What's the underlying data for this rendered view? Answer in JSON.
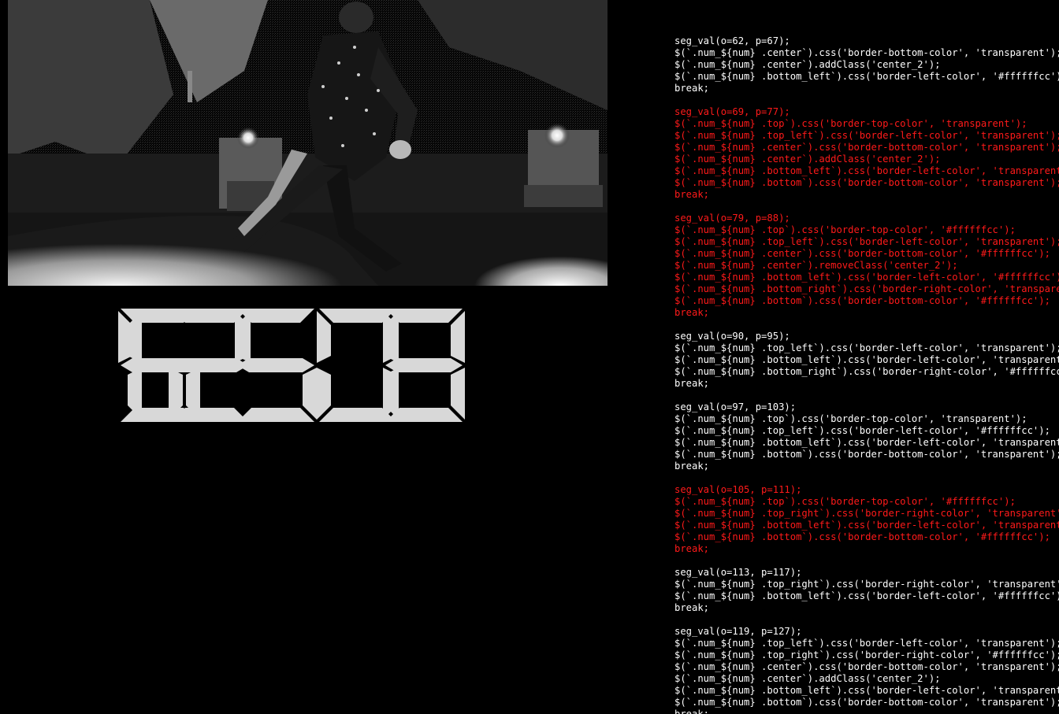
{
  "video": {
    "subject": "grayscale dither video frame of a dancer mid-step"
  },
  "clock": {
    "digits": [
      "1",
      "5",
      "2",
      "5",
      "0",
      "8"
    ],
    "segment_color": "#d8d8d8"
  },
  "code": {
    "highlight_color": "#ff1a1a",
    "text_color": "#ffffff",
    "blocks": [
      {
        "highlight": false,
        "lines": [
          "seg_val(o=62, p=67);",
          "$(`.num_${num} .center`).css('border-bottom-color', 'transparent');",
          "$(`.num_${num} .center`).addClass('center_2');",
          "$(`.num_${num} .bottom_left`).css('border-left-color', '#ffffffcc');",
          "break;"
        ]
      },
      {
        "highlight": true,
        "lines": [
          "seg_val(o=69, p=77);",
          "$(`.num_${num} .top`).css('border-top-color', 'transparent');",
          "$(`.num_${num} .top_left`).css('border-left-color', 'transparent');",
          "$(`.num_${num} .center`).css('border-bottom-color', 'transparent');",
          "$(`.num_${num} .center`).addClass('center_2');",
          "$(`.num_${num} .bottom_left`).css('border-left-color', 'transparent');",
          "$(`.num_${num} .bottom`).css('border-bottom-color', 'transparent');",
          "break;"
        ]
      },
      {
        "highlight": true,
        "lines": [
          "seg_val(o=79, p=88);",
          "$(`.num_${num} .top`).css('border-top-color', '#ffffffcc');",
          "$(`.num_${num} .top_left`).css('border-left-color', 'transparent');",
          "$(`.num_${num} .center`).css('border-bottom-color', '#ffffffcc');",
          "$(`.num_${num} .center`).removeClass('center_2');",
          "$(`.num_${num} .bottom_left`).css('border-left-color', '#ffffffcc');",
          "$(`.num_${num} .bottom_right`).css('border-right-color', 'transparent');",
          "$(`.num_${num} .bottom`).css('border-bottom-color', '#ffffffcc');",
          "break;"
        ]
      },
      {
        "highlight": false,
        "lines": [
          "seg_val(o=90, p=95);",
          "$(`.num_${num} .top_left`).css('border-left-color', 'transparent');",
          "$(`.num_${num} .bottom_left`).css('border-left-color', 'transparent');",
          "$(`.num_${num} .bottom_right`).css('border-right-color', '#ffffffcc');",
          "break;"
        ]
      },
      {
        "highlight": false,
        "lines": [
          "seg_val(o=97, p=103);",
          "$(`.num_${num} .top`).css('border-top-color', 'transparent');",
          "$(`.num_${num} .top_left`).css('border-left-color', '#ffffffcc');",
          "$(`.num_${num} .bottom_left`).css('border-left-color', 'transparent');",
          "$(`.num_${num} .bottom`).css('border-bottom-color', 'transparent');",
          "break;"
        ]
      },
      {
        "highlight": true,
        "lines": [
          "seg_val(o=105, p=111);",
          "$(`.num_${num} .top`).css('border-top-color', '#ffffffcc');",
          "$(`.num_${num} .top_right`).css('border-right-color', 'transparent');",
          "$(`.num_${num} .bottom_left`).css('border-left-color', 'transparent');",
          "$(`.num_${num} .bottom`).css('border-bottom-color', '#ffffffcc');",
          "break;"
        ]
      },
      {
        "highlight": false,
        "lines": [
          "seg_val(o=113, p=117);",
          "$(`.num_${num} .top_right`).css('border-right-color', 'transparent');",
          "$(`.num_${num} .bottom_left`).css('border-left-color', '#ffffffcc');",
          "break;"
        ]
      },
      {
        "highlight": false,
        "lines": [
          "seg_val(o=119, p=127);",
          "$(`.num_${num} .top_left`).css('border-left-color', 'transparent');",
          "$(`.num_${num} .top_right`).css('border-right-color', '#ffffffcc');",
          "$(`.num_${num} .center`).css('border-bottom-color', 'transparent');",
          "$(`.num_${num} .center`).addClass('center_2');",
          "$(`.num_${num} .bottom_left`).css('border-left-color', 'transparent');",
          "$(`.num_${num} .bottom`).css('border-bottom-color', 'transparent');",
          "break;"
        ]
      }
    ]
  }
}
